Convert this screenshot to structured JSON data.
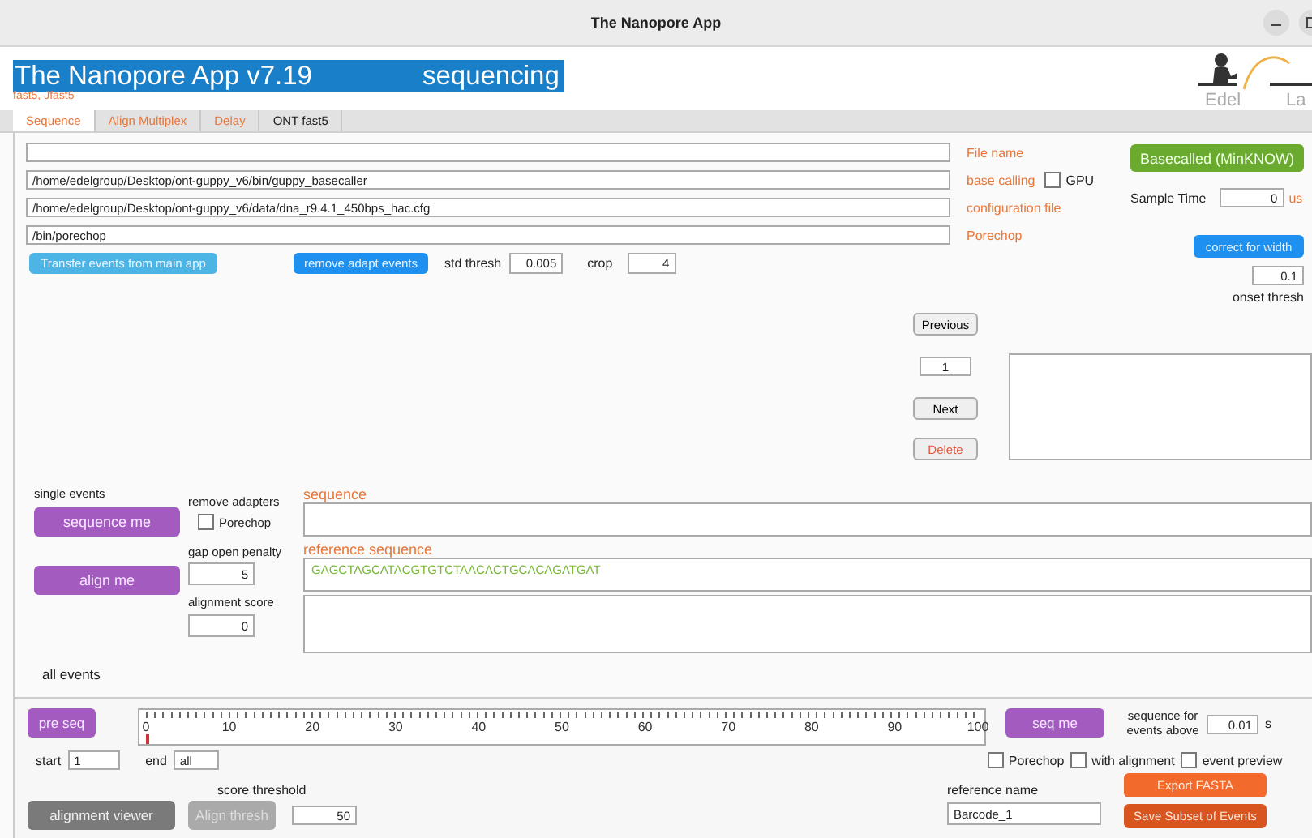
{
  "window": {
    "title": "The Nanopore App"
  },
  "header": {
    "title": "The Nanopore App v7.19",
    "mode": "sequencing",
    "formats": "fast5, Jfast5",
    "logo": [
      "Edel",
      "La"
    ]
  },
  "tabs": [
    {
      "label": "Sequence",
      "selected": true,
      "color": "#e8773a"
    },
    {
      "label": "Align Multiplex",
      "selected": false,
      "color": "#e8773a"
    },
    {
      "label": "Delay",
      "selected": false,
      "color": "#e8773a"
    },
    {
      "label": "ONT fast5",
      "selected": false,
      "color": "#222222"
    }
  ],
  "paths": [
    {
      "label": "File name"
    },
    {
      "value": "/home/edelgroup/Desktop/ont-guppy_v6/bin/guppy_basecaller",
      "label": "base calling",
      "option": {
        "label": "GPU",
        "checked": false
      }
    },
    {
      "value": "/home/edelgroup/Desktop/ont-guppy_v6/data/dna_r9.4.1_450bps_hac.cfg",
      "label": "configuration file"
    },
    {
      "value": "/bin/porechop",
      "label": "Porechop"
    }
  ],
  "actions": {
    "transfer_button": "Transfer events from main app",
    "remove_button": "remove adapt events",
    "std_thresh": {
      "label": "std thresh",
      "value": "0.005"
    },
    "crop": {
      "label": "crop",
      "value": "4"
    }
  },
  "right_panel": {
    "basecalled_button": "Basecalled (MinKNOW)",
    "sample_time": {
      "label": "Sample Time",
      "value": "0",
      "unit": "us"
    },
    "correct_button": "correct for width",
    "onset": {
      "value": "0.1",
      "label": "onset thresh"
    }
  },
  "navigator": {
    "previous": "Previous",
    "index": "1",
    "next": "Next",
    "delete": "Delete"
  },
  "single_events": {
    "title": "single events",
    "sequence_button": "sequence me",
    "align_button": "align me",
    "remove_adapters": {
      "label": "remove adapters",
      "option": {
        "label": "Porechop",
        "checked": false
      }
    },
    "gap_open_penalty": {
      "label": "gap open penalty",
      "value": "5"
    },
    "alignment_score": {
      "label": "alignment score",
      "value": "0"
    },
    "sequence": {
      "label": "sequence"
    },
    "reference_sequence": {
      "label": "reference sequence",
      "value": "GAGCTAGCATACGTGTCTAACACTGCACAGATGAT"
    }
  },
  "all_events": {
    "title": "all events",
    "pre_seq_button": "pre seq",
    "slider": {
      "level": 0,
      "ticks": [
        "0",
        "10",
        "20",
        "30",
        "40",
        "50",
        "60",
        "70",
        "80",
        "90",
        "100"
      ]
    },
    "seq_me_button": "seq me",
    "threshold": {
      "label": "sequence for events above",
      "value": "0.01",
      "unit": "s"
    },
    "start": {
      "label": "start",
      "value": "1"
    },
    "end": {
      "label": "end",
      "value": "all"
    },
    "options": [
      {
        "label": "Porechop",
        "checked": false
      },
      {
        "label": "with alignment",
        "checked": false
      },
      {
        "label": "event preview",
        "checked": false
      }
    ],
    "score_threshold": {
      "label": "score threshold",
      "value": "50"
    },
    "alignment_viewer_button": "alignment viewer",
    "align_thresh_button": {
      "label": "Align thresh",
      "disabled": true
    },
    "reference_name": {
      "label": "reference name",
      "value": "Barcode_1"
    },
    "export_button": "Export FASTA",
    "save_button": "Save Subset of Events"
  }
}
